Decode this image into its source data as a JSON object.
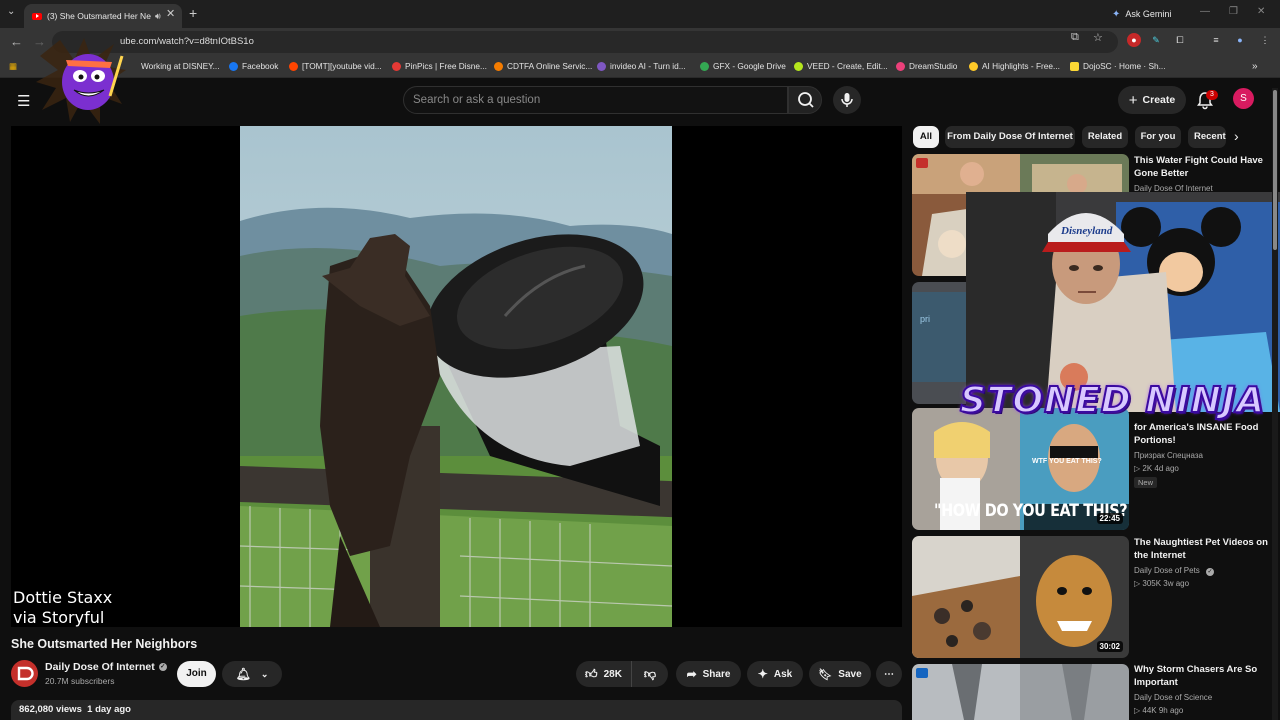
{
  "browser": {
    "tab_title": "(3) She Outsmarted Her Ne",
    "url": "ube.com/watch?v=d8tnIOtBS1o",
    "ask_gemini": "Ask Gemini",
    "bookmarks": [
      "Working at DISNEY...",
      "Facebook",
      "[TOMT][youtube vid...",
      "PinPics | Free Disne...",
      "CDTFA Online Servic...",
      "invideo AI - Turn id...",
      "GFX - Google Drive",
      "VEED - Create, Edit...",
      "DreamStudio",
      "AI Highlights - Free...",
      "DojoSC · Home · Sh..."
    ]
  },
  "header": {
    "search_placeholder": "Search or ask a question",
    "create_label": "Create",
    "notification_count": "3",
    "avatar_letter": "S"
  },
  "video": {
    "credit_line1": "Dottie Staxx",
    "credit_line2": "via Storyful",
    "title": "She Outsmarted Her Neighbors",
    "channel": "Daily Dose Of Internet",
    "subscribers": "20.7M subscribers",
    "join_label": "Join",
    "likes": "28K",
    "share_label": "Share",
    "ask_label": "Ask",
    "save_label": "Save",
    "views": "862,080 views",
    "age": "1 day ago"
  },
  "chips": [
    "All",
    "From Daily Dose Of Internet",
    "Related",
    "For you",
    "Recent"
  ],
  "recommendations": [
    {
      "title": "This Water Fight Could Have Gone Better",
      "channel": "Daily Dose Of Internet",
      "meta": "",
      "duration": ""
    },
    {
      "title": "for America's INSANE Food Portions!",
      "channel": "Призрак Спецназа",
      "meta": "▷ 2K  4d ago",
      "duration": "22:45",
      "badge": "New",
      "thumb_caption": "\"HOW DO YOU EAT THIS?!\"",
      "thumb_sub": "WTF YOU EAT THIS?"
    },
    {
      "title": "The Naughtiest Pet Videos on the Internet",
      "channel": "Daily Dose of Pets",
      "meta": "▷ 305K  3w ago",
      "duration": "30:02"
    },
    {
      "title": "Why Storm Chasers Are So Important",
      "channel": "Daily Dose of Science",
      "meta": "▷ 44K  9h ago",
      "duration": ""
    }
  ],
  "overlay": {
    "streamer_text": "STONED NINJA"
  }
}
